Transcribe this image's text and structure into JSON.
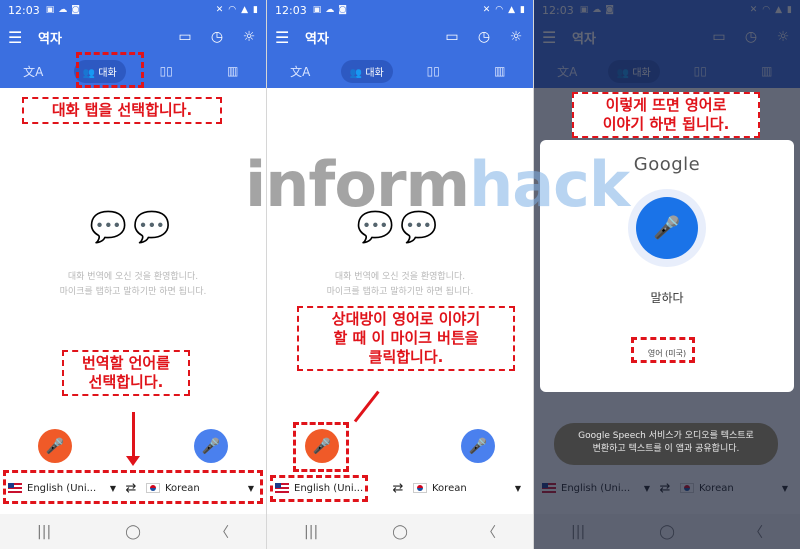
{
  "common": {
    "time": "12:03",
    "app_title": "역자",
    "tab_conversation": "대화",
    "empty_line1": "대화 번역에 오신 것을 환영합니다.",
    "empty_line2": "마이크를 탭하고 말하기만 하면 됩니다.",
    "lang_left": "English (Uni...",
    "lang_right": "Korean",
    "icons": {
      "menu": "menu-icon",
      "conversation_mode": "conversation-mode-icon",
      "history": "clock-icon",
      "brightness": "brightness-icon",
      "translate": "translate-icon",
      "dictionary": "book-icon",
      "phrasebook": "phrasebook-icon",
      "mic": "microphone-icon",
      "swap": "swap-icon"
    }
  },
  "panel1": {
    "callout_tab": "대화 탭을 선택합니다.",
    "callout_lang_line1": "번역할 언어를",
    "callout_lang_line2": "선택합니다."
  },
  "panel2": {
    "callout_line1": "상대방이 영어로 이야기",
    "callout_line2": "할 때 이 마이크 버튼을",
    "callout_line3": "클릭합니다."
  },
  "panel3": {
    "callout_line1": "이렇게 뜨면 영어로",
    "callout_line2": "이야기 하면 됩니다.",
    "google_logo": "Google",
    "speak_prompt": "말하다",
    "speech_lang": "영어 (미국)",
    "toast_line1": "Google Speech 서비스가 오디오를 텍스트로",
    "toast_line2": "변환하고 텍스트를 이 앱과 공유합니다."
  },
  "watermark": {
    "part1": "inform",
    "part2": "hack"
  },
  "colors": {
    "brand_blue": "#3b6fe0",
    "mic_orange": "#f05a28",
    "mic_blue": "#4a80ee",
    "annotation_red": "#e0131a",
    "google_blue": "#1a73e8"
  }
}
